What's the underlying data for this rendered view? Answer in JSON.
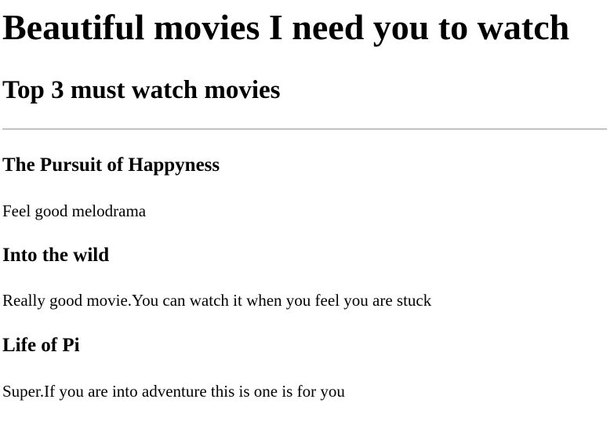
{
  "page": {
    "title": "Beautiful movies I need you to watch",
    "subtitle": "Top 3 must watch movies"
  },
  "movies": [
    {
      "title": "The Pursuit of Happyness",
      "description": "Feel good melodrama"
    },
    {
      "title": "Into the wild",
      "description": "Really good movie.You can watch it when you feel you are stuck"
    },
    {
      "title": "Life of Pi",
      "description": "Super.If you are into adventure this is one is for you"
    }
  ]
}
